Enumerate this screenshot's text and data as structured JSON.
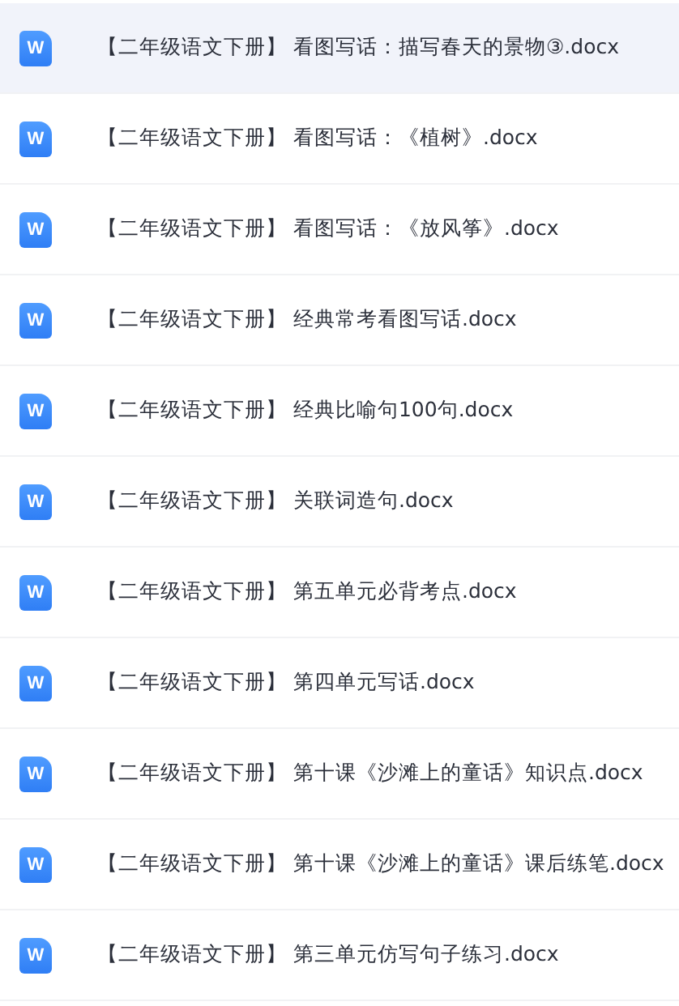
{
  "files": [
    {
      "icon_text": "W",
      "name": "【二年级语文下册】 看图写话：描写春天的景物③.docx",
      "selected": true
    },
    {
      "icon_text": "W",
      "name": "【二年级语文下册】 看图写话：《植树》.docx",
      "selected": false
    },
    {
      "icon_text": "W",
      "name": "【二年级语文下册】 看图写话：《放风筝》.docx",
      "selected": false
    },
    {
      "icon_text": "W",
      "name": "【二年级语文下册】 经典常考看图写话.docx",
      "selected": false
    },
    {
      "icon_text": "W",
      "name": "【二年级语文下册】 经典比喻句100句.docx",
      "selected": false
    },
    {
      "icon_text": "W",
      "name": "【二年级语文下册】 关联词造句.docx",
      "selected": false
    },
    {
      "icon_text": "W",
      "name": "【二年级语文下册】 第五单元必背考点.docx",
      "selected": false
    },
    {
      "icon_text": "W",
      "name": "【二年级语文下册】 第四单元写话.docx",
      "selected": false
    },
    {
      "icon_text": "W",
      "name": "【二年级语文下册】 第十课《沙滩上的童话》知识点.docx",
      "selected": false
    },
    {
      "icon_text": "W",
      "name": "【二年级语文下册】 第十课《沙滩上的童话》课后练笔.docx",
      "selected": false
    },
    {
      "icon_text": "W",
      "name": "【二年级语文下册】 第三单元仿写句子练习.docx",
      "selected": false
    }
  ]
}
